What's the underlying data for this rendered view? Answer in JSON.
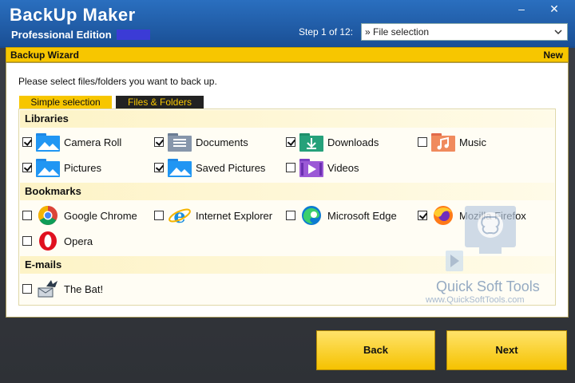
{
  "window": {
    "title": "BackUp Maker",
    "edition": "Professional Edition",
    "minimize_glyph": "–",
    "close_glyph": "✕"
  },
  "step": {
    "label": "Step 1 of 12:",
    "selected": "» File selection"
  },
  "wizard": {
    "title": "Backup Wizard",
    "badge": "New",
    "instruction": "Please select files/folders you want to back up."
  },
  "tabs": [
    {
      "label": "Simple selection",
      "active": true
    },
    {
      "label": "Files & Folders",
      "active": false
    }
  ],
  "sections": {
    "libraries": {
      "title": "Libraries",
      "items": [
        {
          "label": "Camera Roll",
          "checked": true,
          "icon": "camera-roll-folder-icon"
        },
        {
          "label": "Documents",
          "checked": true,
          "icon": "documents-folder-icon"
        },
        {
          "label": "Downloads",
          "checked": true,
          "icon": "downloads-folder-icon"
        },
        {
          "label": "Music",
          "checked": false,
          "icon": "music-folder-icon"
        },
        {
          "label": "Pictures",
          "checked": true,
          "icon": "pictures-folder-icon"
        },
        {
          "label": "Saved Pictures",
          "checked": true,
          "icon": "saved-pictures-folder-icon"
        },
        {
          "label": "Videos",
          "checked": false,
          "icon": "videos-folder-icon"
        }
      ]
    },
    "bookmarks": {
      "title": "Bookmarks",
      "items": [
        {
          "label": "Google Chrome",
          "checked": false,
          "icon": "chrome-icon"
        },
        {
          "label": "Internet Explorer",
          "checked": false,
          "icon": "internet-explorer-icon"
        },
        {
          "label": "Microsoft Edge",
          "checked": false,
          "icon": "edge-icon"
        },
        {
          "label": "Mozilla Firefox",
          "checked": true,
          "icon": "firefox-icon"
        },
        {
          "label": "Opera",
          "checked": false,
          "icon": "opera-icon"
        }
      ]
    },
    "emails": {
      "title": "E-mails",
      "items": [
        {
          "label": "The Bat!",
          "checked": false,
          "icon": "the-bat-icon"
        }
      ]
    }
  },
  "buttons": {
    "back": "Back",
    "next": "Next"
  },
  "watermark": {
    "text": "Quick Soft Tools",
    "url": "www.QuickSoftTools.com"
  },
  "colors": {
    "accent": "#f7c600",
    "title_bar": "#1f5ea8"
  }
}
